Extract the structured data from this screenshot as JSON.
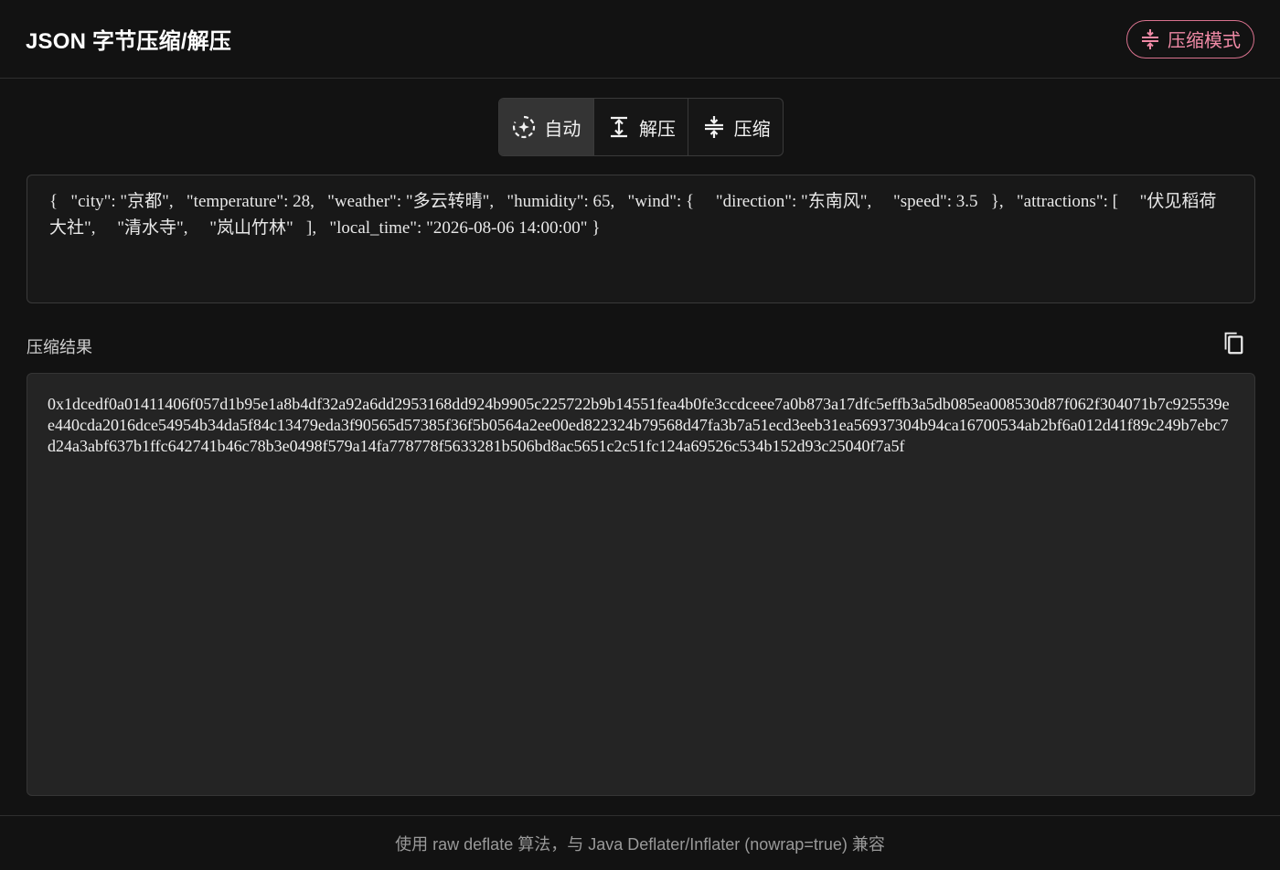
{
  "header": {
    "title": "JSON 字节压缩/解压",
    "mode_badge": {
      "label": "压缩模式",
      "icon": "compress-icon",
      "color": "#f08aa6"
    }
  },
  "mode_selector": {
    "selected": "自动",
    "options": [
      {
        "label": "自动",
        "icon": "auto-sparkle-icon"
      },
      {
        "label": "解压",
        "icon": "expand-vertical-icon"
      },
      {
        "label": "压缩",
        "icon": "compress-icon"
      }
    ]
  },
  "input": {
    "value": "{   \"city\": \"京都\",   \"temperature\": 28,   \"weather\": \"多云转晴\",   \"humidity\": 65,   \"wind\": {     \"direction\": \"东南风\",     \"speed\": 3.5   },   \"attractions\": [     \"伏见稻荷大社\",     \"清水寺\",     \"岚山竹林\"   ],   \"local_time\": \"2026-08-06 14:00:00\" }"
  },
  "result": {
    "label": "压缩结果",
    "copy_icon": "copy-icon",
    "value": "0x1dcedf0a01411406f057d1b95e1a8b4df32a92a6dd2953168dd924b9905c225722b9b14551fea4b0fe3ccdceee7a0b873a17dfc5effb3a5db085ea008530d87f062f304071b7c925539ee440cda2016dce54954b34da5f84c13479eda3f90565d57385f36f5b0564a2ee00ed822324b79568d47fa3b7a51ecd3eeb31ea56937304b94ca16700534ab2bf6a012d41f89c249b7ebc7d24a3abf637b1ffc642741b46c78b3e0498f579a14fa778778f5633281b506bd8ac5651c2c51fc124a69526c534b152d93c25040f7a5f"
  },
  "footer": {
    "note": "使用 raw deflate 算法，与 Java Deflater/Inflater (nowrap=true) 兼容"
  }
}
